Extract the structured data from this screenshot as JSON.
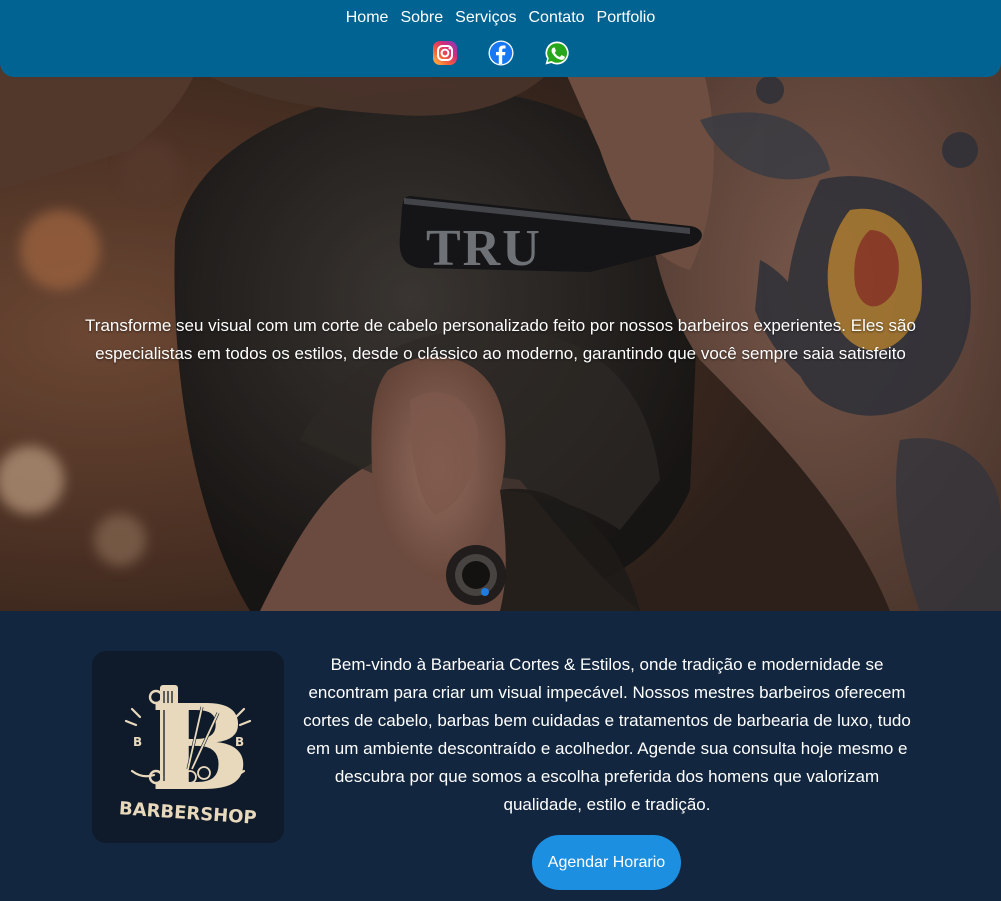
{
  "nav": {
    "items": [
      {
        "label": "Home"
      },
      {
        "label": "Sobre"
      },
      {
        "label": "Serviços"
      },
      {
        "label": "Contato"
      },
      {
        "label": "Portfolio"
      }
    ]
  },
  "socials": [
    {
      "icon": "instagram-icon"
    },
    {
      "icon": "facebook-icon"
    },
    {
      "icon": "whatsapp-icon"
    }
  ],
  "hero": {
    "razor_brand": "TRU",
    "text": "Transforme seu visual com um corte de cabelo personalizado feito por nossos barbeiros experientes. Eles são especialistas em todos os estilos, desde o clássico ao moderno, garantindo que você sempre saia satisfeito",
    "carousel": {
      "current": 1,
      "total": 1
    }
  },
  "about": {
    "logo": {
      "letter": "B",
      "side_letters": [
        "B",
        "B"
      ],
      "wordmark": "BARBERSHOP"
    },
    "text": "Bem-vindo à Barbearia Cortes & Estilos, onde tradição e modernidade se encontram para criar um visual impecável. Nossos mestres barbeiros oferecem cortes de cabelo, barbas bem cuidadas e tratamentos de barbearia de luxo, tudo em um ambiente descontraído e acolhedor. Agende sua consulta hoje mesmo e descubra por que somos a escolha preferida dos homens que valorizam qualidade, estilo e tradição.",
    "cta_label": "Agendar Horario"
  },
  "colors": {
    "header": "#006392",
    "page_bg": "#12263f",
    "cta": "#1d8fe0",
    "carousel_dot": "#1e7be0"
  }
}
